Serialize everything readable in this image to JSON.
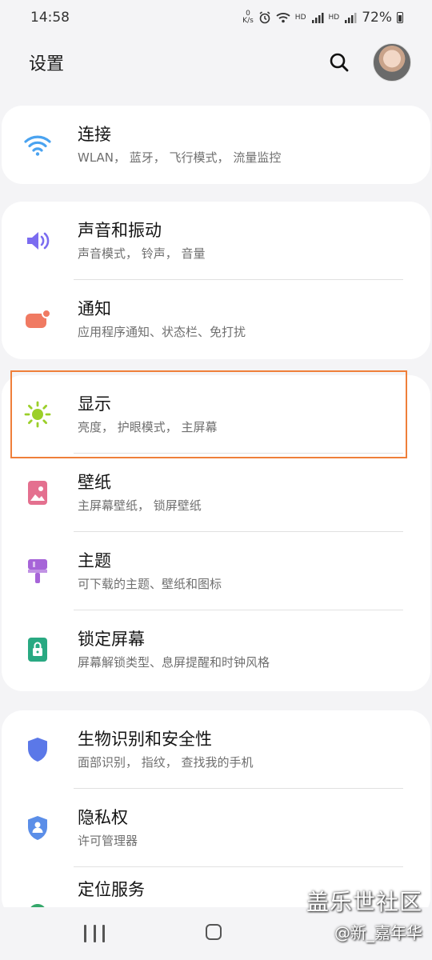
{
  "status": {
    "time": "14:58",
    "net_speed_top": "0",
    "net_speed_unit": "K/s",
    "hd1": "HD",
    "hd2": "HD",
    "sig": "4G",
    "battery": "72%"
  },
  "header": {
    "title": "设置",
    "search_icon": "search-icon",
    "avatar": "user-avatar"
  },
  "groups": [
    {
      "items": [
        {
          "title": "连接",
          "subtitle": "WLAN， 蓝牙， 飞行模式， 流量监控",
          "icon": "wifi-icon",
          "color": "#4aa3f0"
        }
      ]
    },
    {
      "items": [
        {
          "title": "声音和振动",
          "subtitle": "声音模式， 铃声， 音量",
          "icon": "volume-icon",
          "color": "#7b6cf0"
        },
        {
          "title": "通知",
          "subtitle": "应用程序通知、状态栏、免打扰",
          "icon": "notification-icon",
          "color": "#f07a62"
        }
      ]
    },
    {
      "items": [
        {
          "title": "显示",
          "subtitle": "亮度， 护眼模式， 主屏幕",
          "icon": "brightness-icon",
          "color": "#9bcf2a"
        },
        {
          "title": "壁纸",
          "subtitle": "主屏幕壁纸， 锁屏壁纸",
          "icon": "wallpaper-icon",
          "color": "#e4708f"
        },
        {
          "title": "主题",
          "subtitle": "可下载的主题、壁纸和图标",
          "icon": "theme-brush-icon",
          "color": "#a664d8"
        },
        {
          "title": "锁定屏幕",
          "subtitle": "屏幕解锁类型、息屏提醒和时钟风格",
          "icon": "lock-screen-icon",
          "color": "#29a982"
        }
      ]
    },
    {
      "items": [
        {
          "title": "生物识别和安全性",
          "subtitle": "面部识别， 指纹， 查找我的手机",
          "icon": "shield-icon",
          "color": "#5b78e8"
        },
        {
          "title": "隐私权",
          "subtitle": "许可管理器",
          "icon": "privacy-shield-icon",
          "color": "#5b8ee8"
        },
        {
          "title": "定位服务",
          "subtitle": "",
          "icon": "location-icon",
          "color": "#35a86b"
        }
      ]
    }
  ],
  "watermark": {
    "line1": "盖乐世社区",
    "line2": "@新_嘉年华"
  }
}
